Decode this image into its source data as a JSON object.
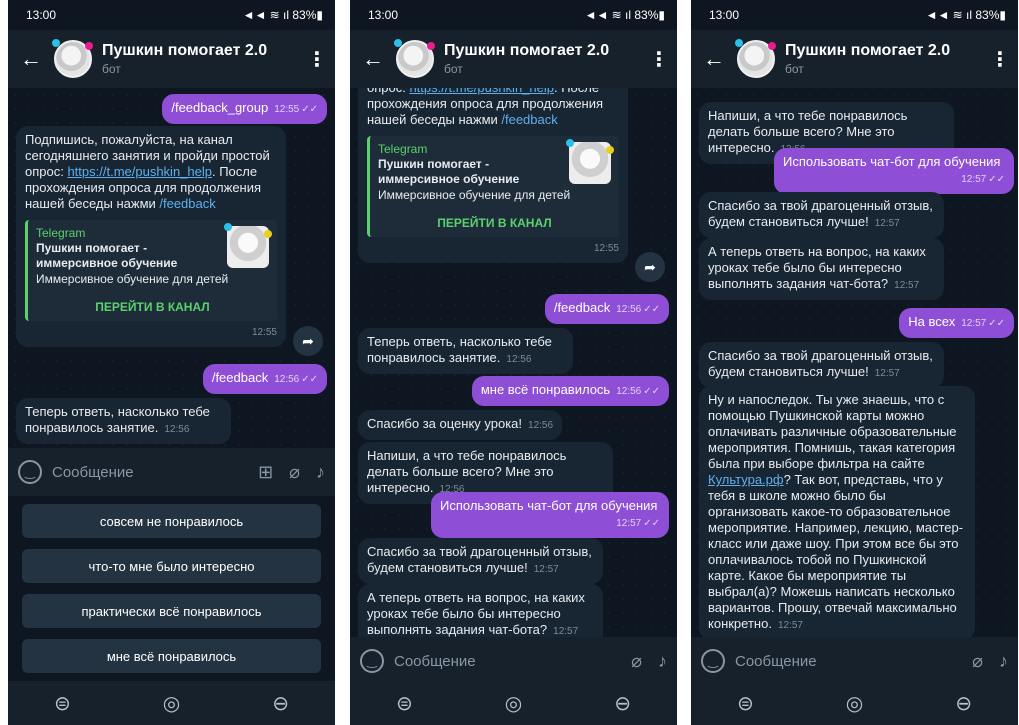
{
  "status": {
    "time": "13:00",
    "right": "◄◄ ≋ ıl 83%▮"
  },
  "chat": {
    "title": "Пушкин помогает 2.0",
    "subtitle": "бот",
    "back": "←",
    "menu": "⋮"
  },
  "input": {
    "placeholder": "Сообщение"
  },
  "nav": {
    "menu": "⊜",
    "home": "◎",
    "back": "⊖"
  },
  "card": {
    "source": "Telegram",
    "title": "Пушкин помогает - иммерсивное обучение",
    "desc": "Иммерсивное обучение для детей",
    "button": "ПЕРЕЙТИ В КАНАЛ"
  },
  "msg": {
    "feedback_group": "/feedback_group",
    "subscribe_pre": "Подпишись, пожалуйста, на канал сегодняшнего занятия и пройди простой опрос: ",
    "subscribe_link": "https://t.me/pushkin_help",
    "subscribe_post": ". После прохождения опроса для продолжения нашей беседы нажми ",
    "subscribe_cmd": "/feedback",
    "feedback": "/feedback",
    "rate_q": "Теперь ответь, насколько тебе понравилось занятие.",
    "all_liked": "мне всё понравилось",
    "thanks_rating": "Спасибо за оценку урока!",
    "what_liked_q": "Напиши, а что тебе понравилось делать больше всего? Мне это интересно.",
    "use_chatbot": "Использовать чат-бот для обучения",
    "thanks_review": "Спасибо за твой драгоценный отзыв, будем становиться лучше!",
    "lessons_q": "А теперь ответь на вопрос, на каких уроках тебе было бы интересно выполнять задания чат-бота?",
    "all_lessons": "На всех",
    "final_1": "Ну и напоследок. Ты уже знаешь, что с помощью Пушкинской карты можно оплачивать различные образовательные мероприятия. Помнишь, такая категория была при выборе фильтра на сайте ",
    "final_link": "Культура.рф",
    "final_2": "? Так вот, представь, что у тебя в школе можно было бы организовать какое-то образовательное мероприятие. Например, лекцию, мастер-класс или даже шоу. При этом все бы это оплачивалось тобой по Пушкинской карте. Какое бы мероприятие ты выбрал(а)? Можешь написать несколько вариантов. Прошу, отвечай максимально конкретно."
  },
  "times": {
    "t1255": "12:55",
    "t1256": "12:56",
    "t1257": "12:57"
  },
  "keyboard": [
    "совсем не понравилось",
    "что-то мне было интересно",
    "практически всё понравилось",
    "мне всё понравилось"
  ]
}
